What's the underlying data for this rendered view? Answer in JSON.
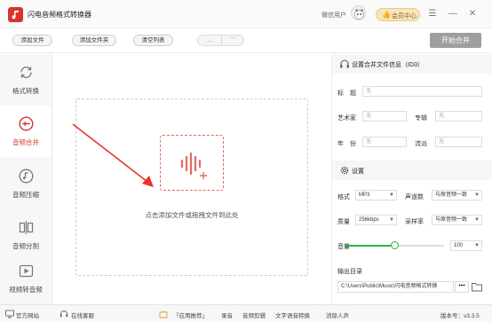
{
  "app": {
    "title": "闪电音频格式转换器",
    "wechat_user": "微信用户",
    "vip_label": "会员中心"
  },
  "toolbar": {
    "add_file": "添加文件",
    "add_folder": "添加文件夹",
    "clear_list": "清空列表",
    "up": "︿",
    "down": "﹀",
    "start_merge": "开始合并"
  },
  "sidebar": {
    "items": [
      {
        "label": "格式转换",
        "icon": "refresh-icon"
      },
      {
        "label": "音频合并",
        "icon": "merge-icon"
      },
      {
        "label": "音频压缩",
        "icon": "music-note-icon"
      },
      {
        "label": "音频分割",
        "icon": "split-icon"
      },
      {
        "label": "视频转音频",
        "icon": "video-play-icon"
      }
    ]
  },
  "main": {
    "drop_text": "点击添加文件或拖拽文件到此处"
  },
  "id3": {
    "title": "设置合并文件信息（ID3）",
    "fields": [
      {
        "label": "标　题",
        "placeholder": "无"
      },
      {
        "label": "艺术家",
        "placeholder": "无"
      },
      {
        "label": "专辑",
        "placeholder": "无"
      },
      {
        "label": "年　份",
        "placeholder": "无"
      },
      {
        "label": "流派",
        "placeholder": "无"
      }
    ]
  },
  "settings": {
    "title": "设置",
    "format_label": "格式",
    "format_value": "MP3",
    "channels_label": "声道数",
    "channels_value": "与原音频一致",
    "quality_label": "质量",
    "quality_value": "256kbps",
    "sample_rate_label": "采样率",
    "sample_rate_value": "与原音频一致",
    "volume_label": "音量",
    "volume_value": "100",
    "volume_fraction": 0.5,
    "output_label": "输出目录",
    "output_path": "C:\\Users\\Public\\Music\\闪电音频格式转换",
    "more": "•••"
  },
  "statusbar": {
    "website": "官方网站",
    "support": "在线客服",
    "recommend": "「应用推荐」",
    "links": [
      "录音",
      "音频剪辑",
      "文字语音转换",
      "消除人声"
    ],
    "version": "版本号：v3.3.5"
  },
  "colors": {
    "accent": "#d9342b",
    "slider": "#2bb34a",
    "vip": "#f8e4bd"
  }
}
